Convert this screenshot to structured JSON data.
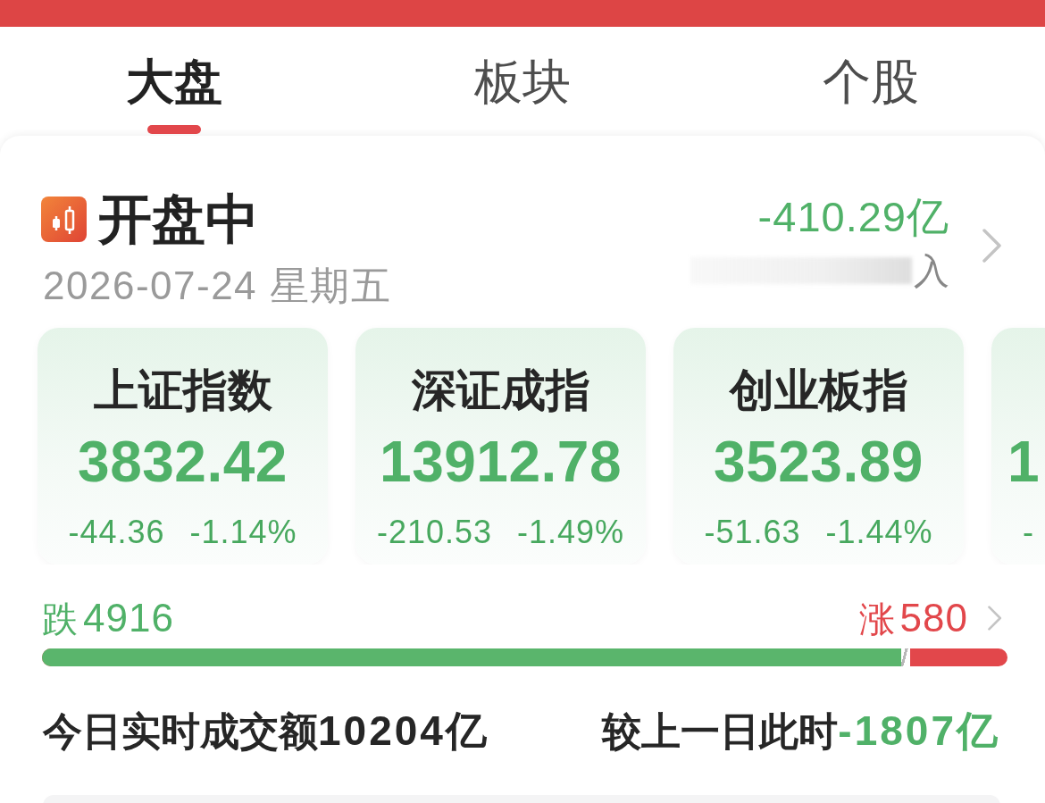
{
  "tabs": [
    {
      "label": "大盘",
      "selected": true
    },
    {
      "label": "板块",
      "selected": false
    },
    {
      "label": "个股",
      "selected": false
    }
  ],
  "market": {
    "status": "开盘中",
    "date": "2026-07-24 星期五",
    "flow": {
      "value": "-410.29亿",
      "label": "入"
    }
  },
  "indices": [
    {
      "name": "上证指数",
      "value": "3832.42",
      "change": "-44.36",
      "change_pct": "-1.14%"
    },
    {
      "name": "深证成指",
      "value": "13912.78",
      "change": "-210.53",
      "change_pct": "-1.49%"
    },
    {
      "name": "创业板指",
      "value": "3523.89",
      "change": "-51.63",
      "change_pct": "-1.44%"
    },
    {
      "value": "1",
      "change": "-"
    }
  ],
  "breadth": {
    "fall_label": "跌",
    "fall_count": "4916",
    "rise_label": "涨",
    "rise_count": "580",
    "level": 0.89
  },
  "turnover": {
    "label": "今日实时成交额",
    "value": "10204亿",
    "compare_label": "较上一日此时",
    "compare_value": "-1807亿"
  }
}
